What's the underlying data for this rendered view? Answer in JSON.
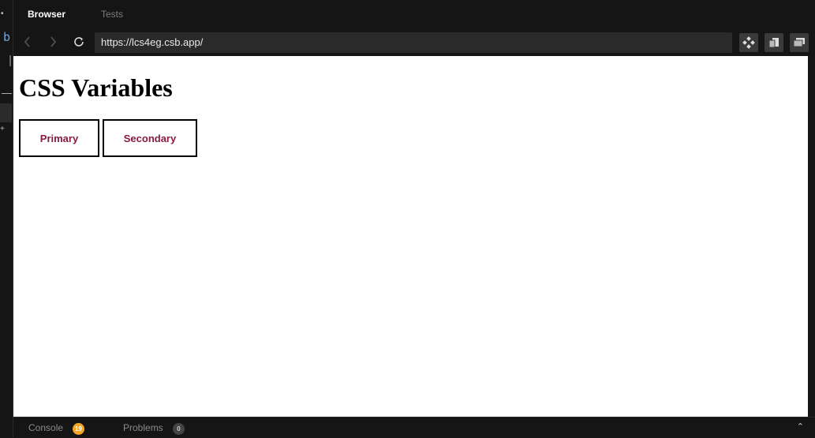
{
  "tabs": {
    "browser": "Browser",
    "tests": "Tests"
  },
  "address_bar": {
    "url": "https://lcs4eg.csb.app/"
  },
  "preview": {
    "title": "CSS Variables",
    "buttons": {
      "primary": "Primary",
      "secondary": "Secondary"
    },
    "button_text_color": "#8b1a3e"
  },
  "bottom": {
    "console_label": "Console",
    "console_count": "19",
    "problems_label": "Problems",
    "problems_count": "0"
  },
  "editor": {
    "visible_char": "b"
  },
  "icons": {
    "back": "chevron-left-icon",
    "forward": "chevron-right-icon",
    "refresh": "refresh-icon",
    "devtools": "diamond-grid-icon",
    "open_new": "copy-window-icon",
    "fullscreen": "window-icon",
    "collapse": "chevron-up-icon"
  }
}
